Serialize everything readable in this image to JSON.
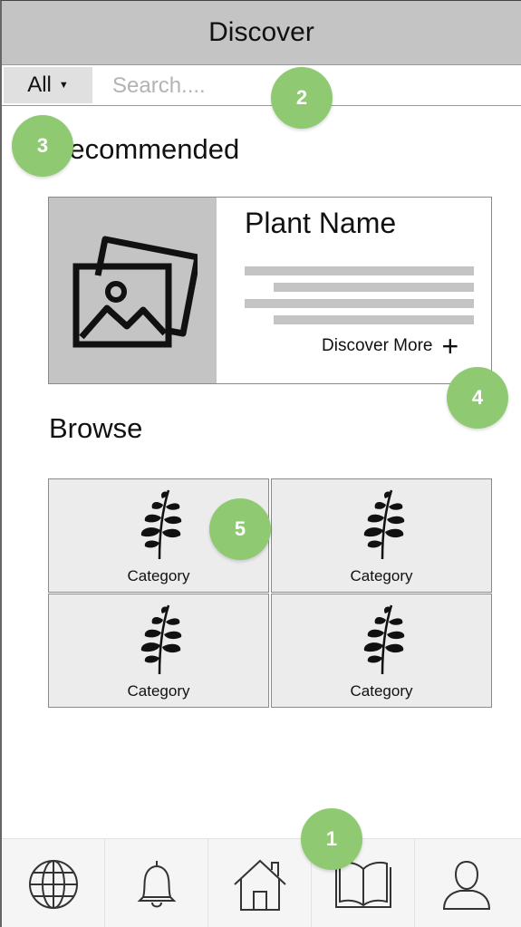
{
  "header": {
    "title": "Discover"
  },
  "search": {
    "filter_label": "All",
    "placeholder": "Search...."
  },
  "recommended": {
    "title": "Recommended",
    "card": {
      "plant_name": "Plant Name",
      "discover_more_label": "Discover More",
      "image_icon": "image-placeholder-icon"
    }
  },
  "browse": {
    "title": "Browse",
    "categories": [
      {
        "label": "Category",
        "icon": "leaf-icon"
      },
      {
        "label": "Category",
        "icon": "leaf-icon"
      },
      {
        "label": "Category",
        "icon": "leaf-icon"
      },
      {
        "label": "Category",
        "icon": "leaf-icon"
      }
    ]
  },
  "bottom_nav": {
    "items": [
      {
        "name": "discover",
        "icon": "globe-icon"
      },
      {
        "name": "notifications",
        "icon": "bell-icon"
      },
      {
        "name": "home",
        "icon": "home-icon"
      },
      {
        "name": "library",
        "icon": "book-icon"
      },
      {
        "name": "profile",
        "icon": "user-icon"
      }
    ]
  },
  "annotations": [
    "1",
    "2",
    "3",
    "4",
    "5"
  ],
  "colors": {
    "header_bg": "#c4c4c4",
    "badge": "#8fca72",
    "tile_bg": "#ececec",
    "placeholder_gray": "#c4c4c4"
  }
}
